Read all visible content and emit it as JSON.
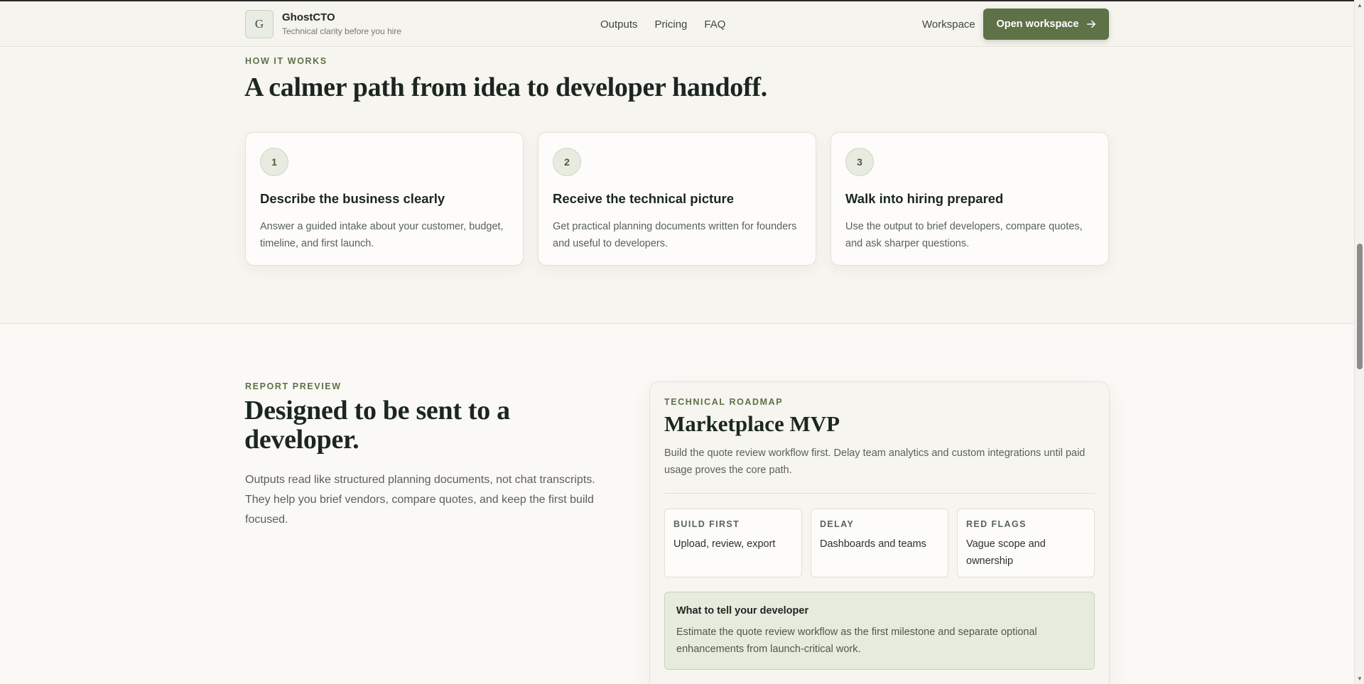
{
  "header": {
    "brand_initial": "G",
    "brand_name": "GhostCTO",
    "brand_tagline": "Technical clarity before you hire",
    "nav": [
      "Outputs",
      "Pricing",
      "FAQ"
    ],
    "workspace_link": "Workspace",
    "cta_label": "Open workspace"
  },
  "how": {
    "eyebrow": "HOW IT WORKS",
    "title": "A calmer path from idea to developer handoff.",
    "steps": [
      {
        "num": "1",
        "title": "Describe the business clearly",
        "desc": "Answer a guided intake about your customer, budget, timeline, and first launch."
      },
      {
        "num": "2",
        "title": "Receive the technical picture",
        "desc": "Get practical planning documents written for founders and useful to developers."
      },
      {
        "num": "3",
        "title": "Walk into hiring prepared",
        "desc": "Use the output to brief developers, compare quotes, and ask sharper questions."
      }
    ]
  },
  "preview": {
    "eyebrow": "REPORT PREVIEW",
    "title": "Designed to be sent to a developer.",
    "desc": "Outputs read like structured planning documents, not chat transcripts. They help you brief vendors, compare quotes, and keep the first build focused.",
    "report": {
      "eyebrow": "TECHNICAL ROADMAP",
      "title": "Marketplace MVP",
      "desc": "Build the quote review workflow first. Delay team analytics and custom integrations until paid usage proves the core path.",
      "cards": [
        {
          "label": "BUILD FIRST",
          "text": "Upload, review, export"
        },
        {
          "label": "DELAY",
          "text": "Dashboards and teams"
        },
        {
          "label": "RED FLAGS",
          "text": "Vague scope and ownership"
        }
      ],
      "tell_title": "What to tell your developer",
      "tell_text": "Estimate the quote review workflow as the first milestone and separate optional enhancements from launch-critical work."
    }
  },
  "colors": {
    "accent": "#5e7147",
    "background": "#faf9f6",
    "heading": "#1c2620"
  },
  "icons": {
    "cta": "arrow-right-icon"
  }
}
